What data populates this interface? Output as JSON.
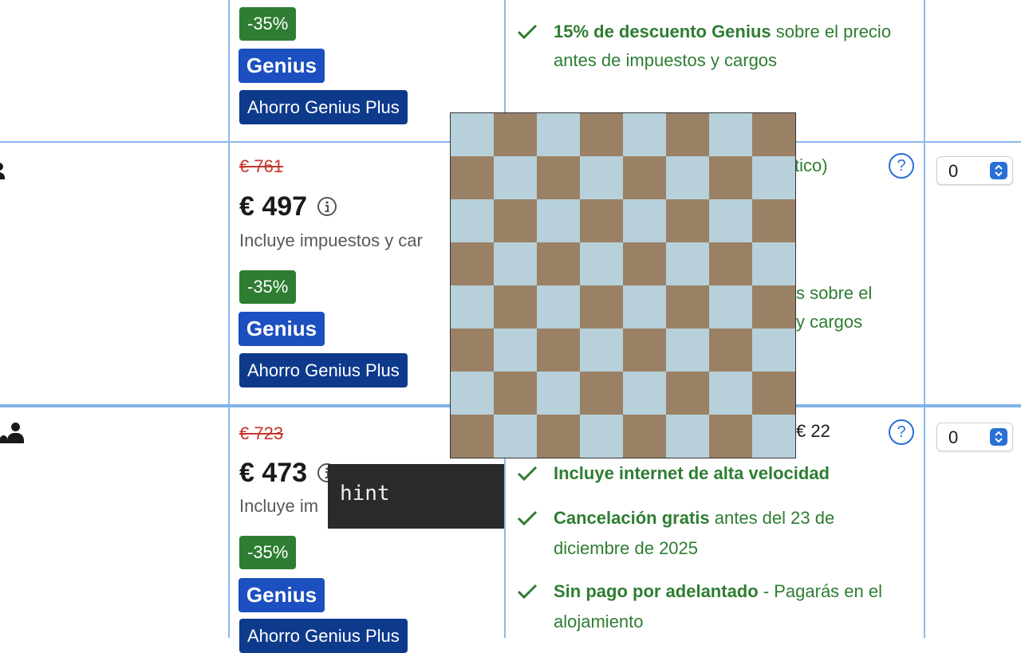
{
  "rows": [
    {
      "discount": "-35%",
      "genius": "Genius",
      "genius_plus": "Ahorro Genius Plus",
      "benefit_bold": "15% de descuento Genius",
      "benefit_rest": " sobre el precio antes de impuestos y cargos"
    },
    {
      "old_price": "€ 761",
      "price": "€ 497",
      "taxes": "Incluye impuestos y car",
      "discount": "-35%",
      "genius": "Genius",
      "genius_plus": "Ahorro Genius Plus",
      "partial_top": "tico)",
      "partial_benefit_a": "s sobre el",
      "partial_benefit_b": "y cargos",
      "help": "?",
      "select_value": "0"
    },
    {
      "old_price": "€ 723",
      "price": "€ 473",
      "taxes": "Incluye im",
      "discount": "-35%",
      "genius": "Genius",
      "genius_plus": "Ahorro Genius Plus",
      "partial_top": "22",
      "benefits": [
        {
          "bold": "Incluye internet de alta velocidad",
          "rest": ""
        },
        {
          "bold": "Cancelación gratis",
          "rest": " antes del 23 de diciembre de 2025"
        },
        {
          "bold": "Sin pago por adelantado",
          "rest": " - Pagarás en el alojamiento"
        }
      ],
      "help": "?",
      "select_value": "0"
    }
  ],
  "tooltip": {
    "text": "hint"
  },
  "colors": {
    "border_blue": "#8ab9ec",
    "discount_green": "#2e7d32",
    "genius_blue": "#1c4fbf",
    "genius_plus_navy": "#0e3a8c",
    "old_price_red": "#c5352a",
    "board_light": "#b7d0d9",
    "board_dark": "#9a8166"
  }
}
